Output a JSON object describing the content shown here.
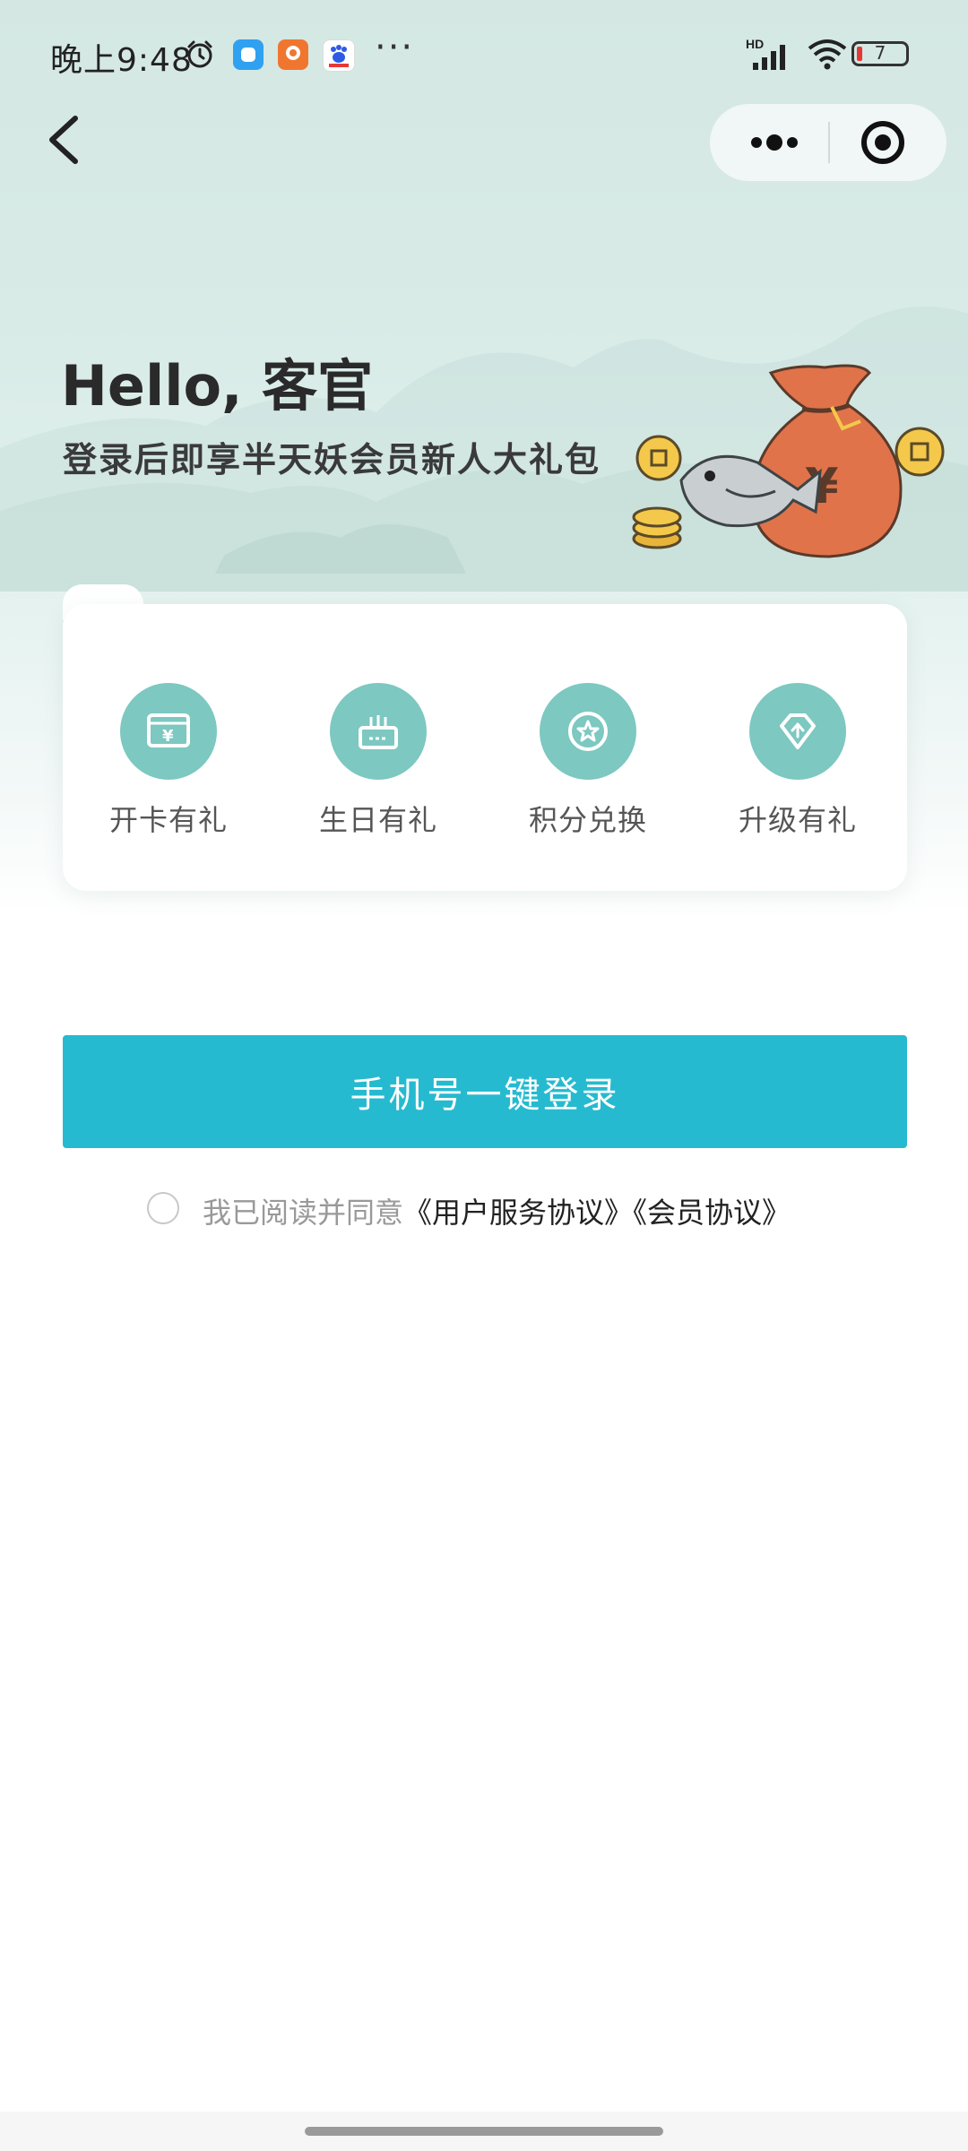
{
  "status_bar": {
    "time": "晚上9:48",
    "battery": "7",
    "more": "···",
    "network_label": "HD"
  },
  "hero": {
    "title": "Hello, 客官",
    "subtitle": "登录后即享半天妖会员新人大礼包"
  },
  "benefits": [
    {
      "label": "开卡有礼",
      "icon": "card-gift-icon"
    },
    {
      "label": "生日有礼",
      "icon": "birthday-cake-icon"
    },
    {
      "label": "积分兑换",
      "icon": "points-star-icon"
    },
    {
      "label": "升级有礼",
      "icon": "upgrade-arrow-icon"
    }
  ],
  "login": {
    "button_label": "手机号一键登录"
  },
  "agreement": {
    "prefix": "我已阅读并同意",
    "user_service": "《用户服务协议》",
    "member": "《会员协议》",
    "checked": false
  },
  "colors": {
    "accent": "#26bad0",
    "icon_bg": "#7dc8c1",
    "hero_bg": "#d4e7e3"
  }
}
